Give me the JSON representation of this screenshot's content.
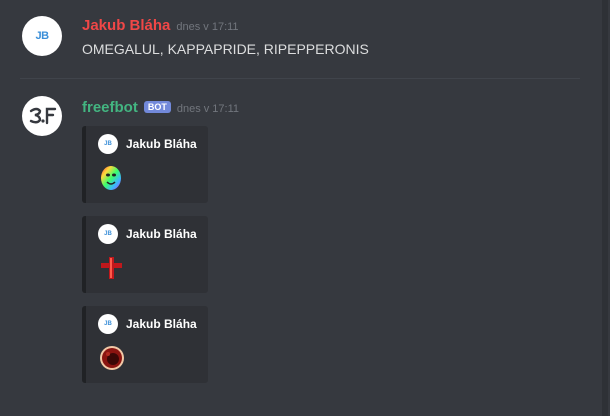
{
  "messages": [
    {
      "avatar_text": "JB",
      "username": "Jakub Bláha",
      "username_color": "#f04747",
      "timestamp": "dnes v 17:11",
      "content": "OMEGALUL, KAPPAPRIDE, RIPEPPERONIS"
    },
    {
      "avatar_text": "ƎƧ.ᖷ",
      "username": "freefbot",
      "username_color": "#43b581",
      "bot_tag": "BOT",
      "timestamp": "dnes v 17:11",
      "embeds": [
        {
          "author_icon_text": "JB",
          "author": "Jakub Bláha",
          "image": "rainbow-face-emote"
        },
        {
          "author_icon_text": "JB",
          "author": "Jakub Bláha",
          "image": "red-cross-emote"
        },
        {
          "author_icon_text": "JB",
          "author": "Jakub Bláha",
          "image": "pepperoni-emote"
        }
      ]
    }
  ]
}
